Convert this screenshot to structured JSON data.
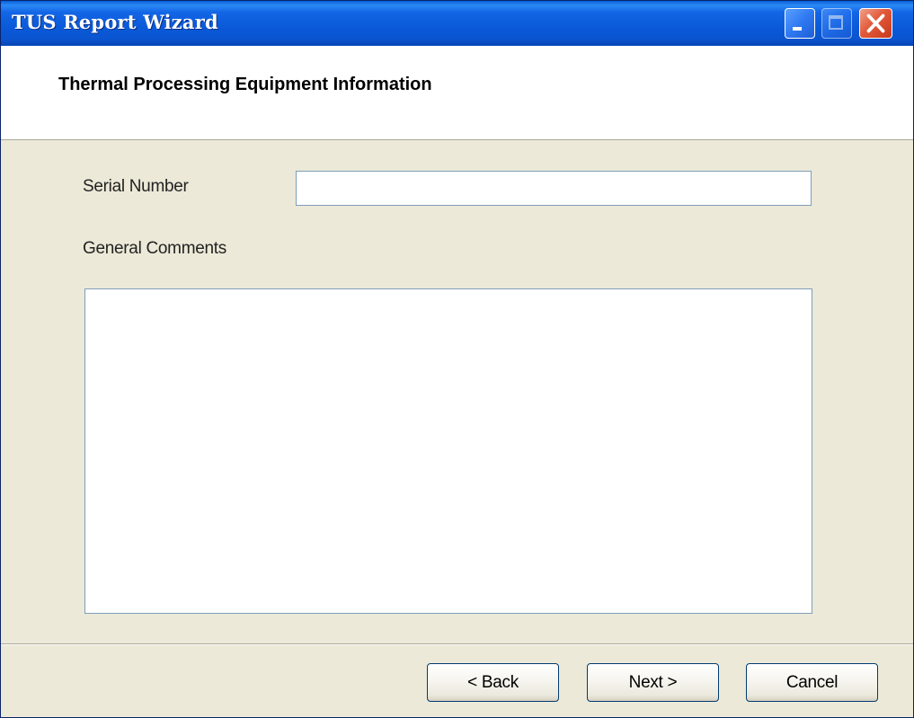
{
  "window": {
    "title": "TUS Report Wizard"
  },
  "header": {
    "title": "Thermal Processing Equipment Information"
  },
  "form": {
    "serial_number_label": "Serial Number",
    "serial_number_value": "",
    "general_comments_label": "General Comments",
    "general_comments_value": ""
  },
  "buttons": {
    "back_label": "< Back",
    "next_label": "Next >",
    "cancel_label": "Cancel"
  },
  "title_buttons": {
    "minimize_icon": "minimize-icon",
    "maximize_icon": "maximize-icon",
    "close_icon": "close-icon",
    "maximize_enabled": false
  },
  "colors": {
    "titlebar": "#0a59d8",
    "window_bg": "#ece9d8",
    "header_bg": "#ffffff",
    "close_button": "#e2593a"
  }
}
